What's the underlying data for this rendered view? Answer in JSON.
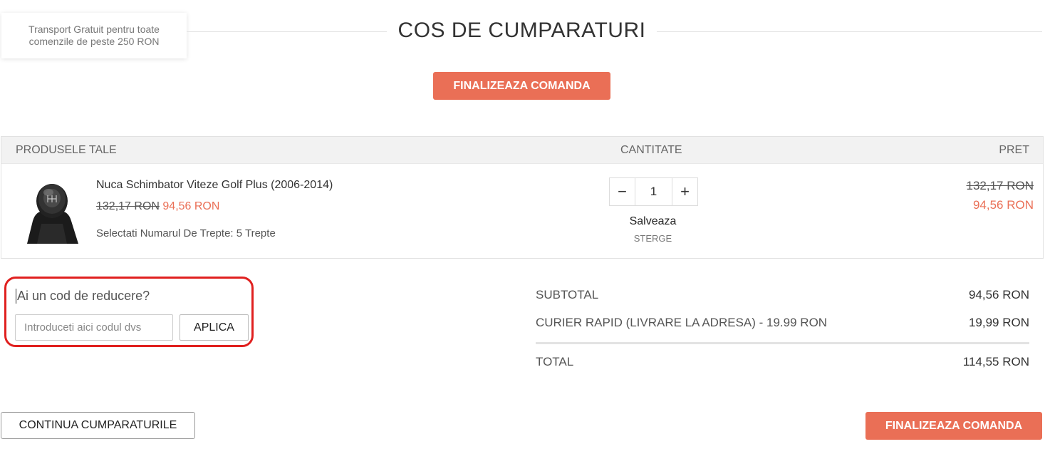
{
  "promo": {
    "text": "Transport Gratuit pentru toate comenzile de peste 250 RON"
  },
  "page": {
    "title": "COS DE CUMPARATURI"
  },
  "buttons": {
    "checkout_top": "FINALIZEAZA COMANDA",
    "checkout_bottom": "FINALIZEAZA COMANDA",
    "continue_shopping": "CONTINUA CUMPARATURILE"
  },
  "table": {
    "headers": {
      "products": "PRODUSELE TALE",
      "quantity": "CANTITATE",
      "price": "PRET"
    }
  },
  "item": {
    "name": "Nuca Schimbator Viteze Golf Plus (2006-2014)",
    "old_price": "132,17 RON",
    "new_price": "94,56 RON",
    "variant": "Selectati Numarul De Trepte: 5 Trepte",
    "quantity": "1",
    "minus_symbol": "−",
    "plus_symbol": "+",
    "save_label": "Salveaza",
    "delete_label": "STERGE",
    "price_old": "132,17 RON",
    "price_new": "94,56 RON"
  },
  "discount": {
    "label": "Ai un cod de reducere?",
    "placeholder": "Introduceti aici codul dvs",
    "apply_label": "APLICA"
  },
  "summary": {
    "subtotal_label": "SUBTOTAL",
    "subtotal_value": "94,56 RON",
    "shipping_label": "CURIER RAPID (LIVRARE LA ADRESA) - 19.99 RON",
    "shipping_value": "19,99 RON",
    "total_label": "TOTAL",
    "total_value": "114,55 RON"
  },
  "colors": {
    "accent": "#ea6f56",
    "highlight_border": "#e0201f"
  }
}
